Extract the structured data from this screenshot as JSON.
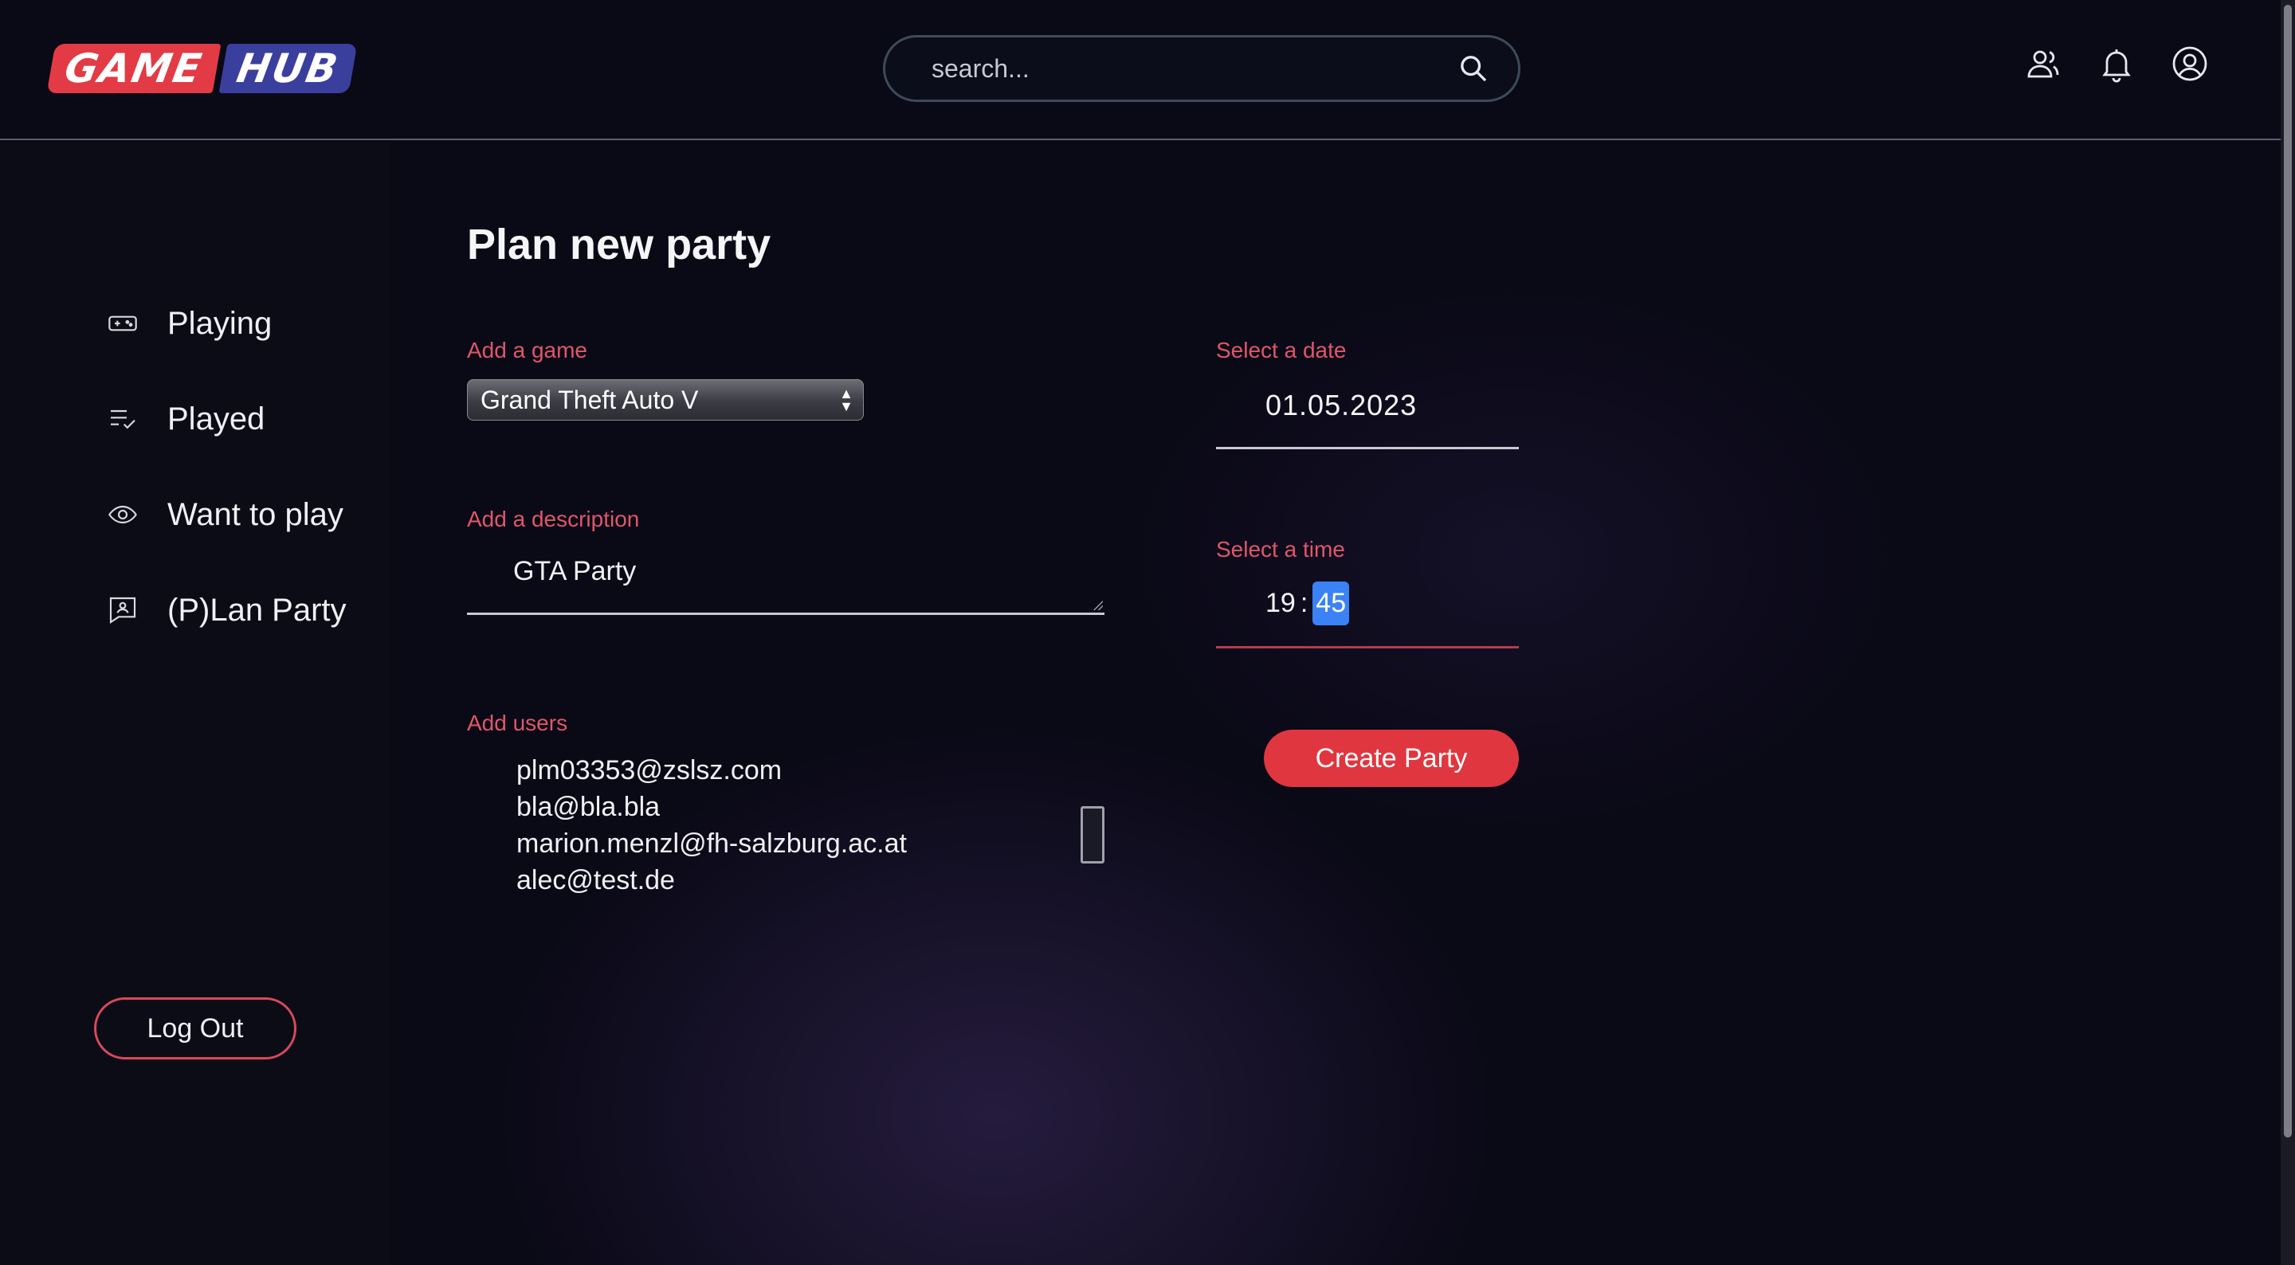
{
  "header": {
    "logo_game": "GAME",
    "logo_hub": "HUB",
    "search_placeholder": "search...",
    "icons": [
      "friends-icon",
      "bell-icon",
      "account-icon"
    ]
  },
  "sidebar": {
    "items": [
      {
        "label": "Playing",
        "icon": "gamepad-icon"
      },
      {
        "label": "Played",
        "icon": "checklist-icon"
      },
      {
        "label": "Want to play",
        "icon": "eye-icon"
      },
      {
        "label": "(P)Lan Party",
        "icon": "party-icon"
      }
    ],
    "logout_label": "Log Out"
  },
  "main": {
    "title": "Plan new party",
    "game_label": "Add a game",
    "game_value": "Grand Theft Auto V",
    "description_label": "Add a description",
    "description_value": "GTA Party",
    "users_label": "Add users",
    "users": [
      "plm03353@zslsz.com",
      "bla@bla.bla",
      "marion.menzl@fh-salzburg.ac.at",
      "alec@test.de"
    ],
    "date_label": "Select a date",
    "date_value": "01.05.2023",
    "time_label": "Select a time",
    "time_hour": "19",
    "time_separator": ":",
    "time_minute": "45",
    "create_label": "Create Party"
  },
  "colors": {
    "accent": "#e0363f",
    "label": "#e0566a",
    "background": "#0a0916",
    "selection": "#3b82f6"
  }
}
